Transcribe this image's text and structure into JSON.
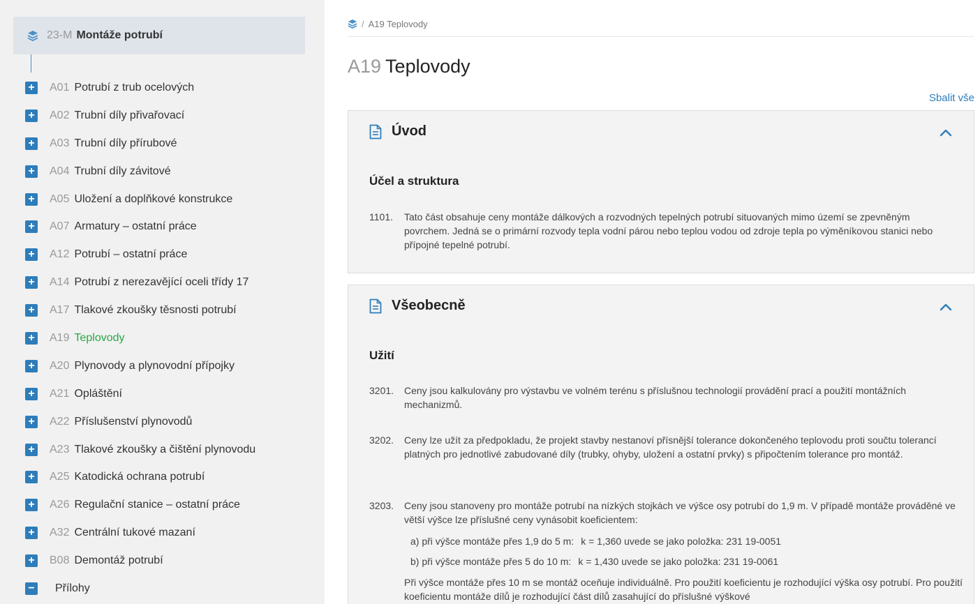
{
  "sidebar": {
    "root": {
      "code": "23-M",
      "label": "Montáže potrubí"
    },
    "items": [
      {
        "code": "A01",
        "label": "Potrubí z trub ocelových"
      },
      {
        "code": "A02",
        "label": "Trubní díly přivařovací"
      },
      {
        "code": "A03",
        "label": "Trubní díly přírubové"
      },
      {
        "code": "A04",
        "label": "Trubní díly závitové"
      },
      {
        "code": "A05",
        "label": "Uložení a doplňkové konstrukce"
      },
      {
        "code": "A07",
        "label": "Armatury – ostatní práce"
      },
      {
        "code": "A12",
        "label": "Potrubí – ostatní práce"
      },
      {
        "code": "A14",
        "label": "Potrubí z nerezavějící oceli třídy 17"
      },
      {
        "code": "A17",
        "label": "Tlakové zkoušky těsnosti potrubí"
      },
      {
        "code": "A19",
        "label": "Teplovody"
      },
      {
        "code": "A20",
        "label": "Plynovody a plynovodní přípojky"
      },
      {
        "code": "A21",
        "label": "Opláštění"
      },
      {
        "code": "A22",
        "label": "Příslušenství plynovodů"
      },
      {
        "code": "A23",
        "label": "Tlakové zkoušky a čištění plynovodu"
      },
      {
        "code": "A25",
        "label": "Katodická ochrana potrubí"
      },
      {
        "code": "A26",
        "label": "Regulační stanice – ostatní práce"
      },
      {
        "code": "A32",
        "label": "Centrální tukové mazaní"
      },
      {
        "code": "B08",
        "label": "Demontáž potrubí"
      }
    ],
    "attachments": {
      "label": "Přílohy"
    },
    "expand_symbol": "+",
    "collapse_symbol": "−"
  },
  "breadcrumb": {
    "separator": "/",
    "current": "A19 Teplovody"
  },
  "page_title": {
    "code": "A19",
    "label": "Teplovody"
  },
  "collapse_all": "Sbalit vše",
  "panels": {
    "intro": {
      "title": "Úvod",
      "section_title": "Účel a struktura",
      "p1101_num": "1101.",
      "p1101_text": "Tato část obsahuje ceny montáže dálkových a rozvodných tepelných potrubí situovaných mimo území se zpevněným povrchem. Jedná se o primární rozvody tepla vodní párou nebo teplou vodou od zdroje tepla po výměníkovou stanici nebo přípojné tepelné potrubí."
    },
    "general": {
      "title": "Všeobecně",
      "section_title": "Užití",
      "p3201_num": "3201.",
      "p3201_text": "Ceny jsou kalkulovány pro výstavbu ve volném terénu s příslušnou technologií provádění prací a použití montážních mechanizmů.",
      "p3202_num": "3202.",
      "p3202_text": "Ceny lze užít za předpokladu, že projekt stavby nestanoví přísnější tolerance dokončeného teplovodu proti součtu tolerancí platných pro jednotlivé zabudované díly (trubky, ohyby, uložení a ostatní prvky) s připočtením tolerance pro montáž.",
      "p3203_num": "3203.",
      "p3203_text": "Ceny jsou stanoveny pro montáže potrubí na nízkých stojkách ve výšce osy potrubí do 1,9 m. V případě montáže prováděné ve větší výšce lze příslušné ceny vynásobit koeficientem:",
      "p3203_a": "a)  při výšce montáže přes 1,9 do 5 m:",
      "p3203_a_k": "k = 1,360 uvede se jako položka: 231 19-0051",
      "p3203_b": "b)  při výšce montáže přes 5 do 10 m:",
      "p3203_b_k": "k = 1,430 uvede se jako položka: 231 19-0061",
      "p3203_more": "Při výšce montáže přes 10 m se montáž oceňuje individuálně. Pro použití koeficientu je rozhodující výška osy potrubí. Pro použití koeficientu montáže dílů je rozhodující část dílů zasahující do příslušné výškové"
    }
  },
  "colors": {
    "accent": "#2e7dba",
    "active": "#28a745",
    "panel_bg": "#f3f3f3",
    "sidebar_bg": "#f1f1f1"
  },
  "icons": [
    "layers-icon",
    "plus-box-icon",
    "minus-box-icon",
    "document-icon",
    "chevron-up-icon"
  ]
}
